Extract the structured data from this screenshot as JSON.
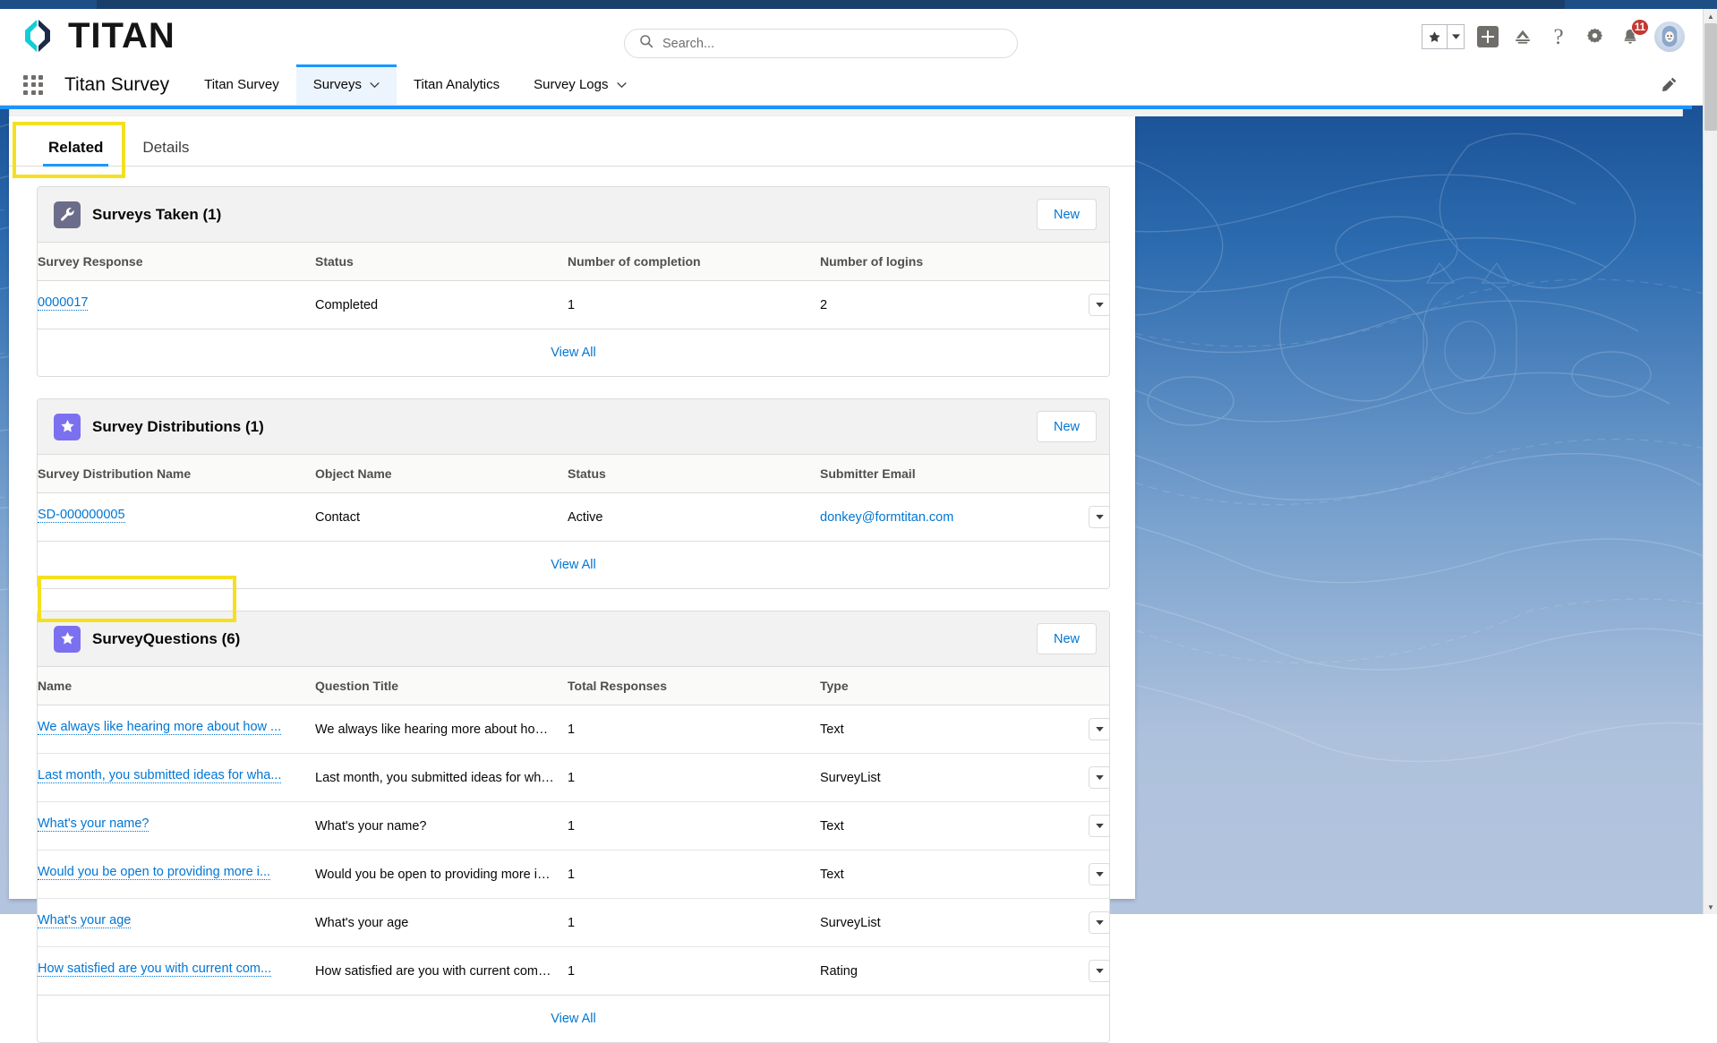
{
  "browser": {
    "chrome_color": "#1d4f86"
  },
  "header": {
    "brand_name": "TITAN",
    "logo_icon": "titan-diamond-logo",
    "search": {
      "placeholder": "Search...",
      "value": "",
      "icon": "search-icon"
    },
    "actions": {
      "favorite_icon": "star-icon",
      "favorite_caret_icon": "chevron-down-icon",
      "add_icon": "plus-icon",
      "cloud_icon": "salesforce-cloud-icon",
      "help_icon": "question-mark-icon",
      "setup_icon": "gear-icon",
      "notifications_icon": "bell-icon",
      "notifications_count": "11",
      "avatar_icon": "astro-avatar-icon"
    }
  },
  "app_nav": {
    "waffle_icon": "app-launcher-icon",
    "app_name": "Titan Survey",
    "edit_icon": "pencil-edit-icon",
    "tabs": [
      {
        "label": "Titan Survey",
        "active": false,
        "has_caret": false
      },
      {
        "label": "Surveys",
        "active": true,
        "has_caret": true
      },
      {
        "label": "Titan Analytics",
        "active": false,
        "has_caret": false
      },
      {
        "label": "Survey Logs",
        "active": false,
        "has_caret": true
      }
    ]
  },
  "record_tabs": [
    {
      "label": "Related",
      "active": true
    },
    {
      "label": "Details",
      "active": false
    }
  ],
  "highlight_color": "#f5e01f",
  "cards": [
    {
      "icon": "wrench-icon",
      "icon_style": "wrench",
      "title": "Surveys Taken",
      "count": "(1)",
      "new_label": "New",
      "columns": [
        "Survey Response",
        "Status",
        "Number of completion",
        "Number of logins"
      ],
      "rows": [
        {
          "name": "0000017",
          "name_is_link": true,
          "c2": "Completed",
          "c2_is_link": false,
          "c3": "1",
          "c4": "2",
          "c4_is_link": false,
          "caret_icon": "row-actions-caret-icon"
        }
      ],
      "footer_label": "View All"
    },
    {
      "icon": "star-icon",
      "icon_style": "star",
      "title": "Survey Distributions",
      "count": "(1)",
      "new_label": "New",
      "columns": [
        "Survey Distribution Name",
        "Object Name",
        "Status",
        "Submitter Email"
      ],
      "rows": [
        {
          "name": "SD-000000005",
          "name_is_link": true,
          "c2": "Contact",
          "c2_is_link": false,
          "c3": "Active",
          "c4": "donkey@formtitan.com",
          "c4_is_link": true,
          "caret_icon": "row-actions-caret-icon"
        }
      ],
      "footer_label": "View All"
    },
    {
      "icon": "star-icon",
      "icon_style": "star",
      "title": "SurveyQuestions",
      "count": "(6)",
      "new_label": "New",
      "columns": [
        "Name",
        "Question Title",
        "Total Responses",
        "Type"
      ],
      "rows": [
        {
          "name": "We always like hearing more about how ...",
          "name_is_link": true,
          "c2": "We always like hearing more about how ...",
          "c2_is_link": false,
          "c3": "1",
          "c4": "Text",
          "c4_is_link": false,
          "caret_icon": "row-actions-caret-icon"
        },
        {
          "name": "Last month, you submitted ideas for wha...",
          "name_is_link": true,
          "c2": "Last month, you submitted ideas for what...",
          "c2_is_link": false,
          "c3": "1",
          "c4": "SurveyList",
          "c4_is_link": false,
          "caret_icon": "row-actions-caret-icon"
        },
        {
          "name": "What's your name?",
          "name_is_link": true,
          "c2": "What's your name?",
          "c2_is_link": false,
          "c3": "1",
          "c4": "Text",
          "c4_is_link": false,
          "caret_icon": "row-actions-caret-icon"
        },
        {
          "name": "Would you be open to providing more i...",
          "name_is_link": true,
          "c2": "Would you be open to providing more in...",
          "c2_is_link": false,
          "c3": "1",
          "c4": "Text",
          "c4_is_link": false,
          "caret_icon": "row-actions-caret-icon"
        },
        {
          "name": "What's your age",
          "name_is_link": true,
          "c2": "What's your age",
          "c2_is_link": false,
          "c3": "1",
          "c4": "SurveyList",
          "c4_is_link": false,
          "caret_icon": "row-actions-caret-icon"
        },
        {
          "name": "How satisfied are you with current com...",
          "name_is_link": true,
          "c2": "How satisfied are you with current comm...",
          "c2_is_link": false,
          "c3": "1",
          "c4": "Rating",
          "c4_is_link": false,
          "caret_icon": "row-actions-caret-icon"
        }
      ],
      "footer_label": "View All"
    }
  ]
}
